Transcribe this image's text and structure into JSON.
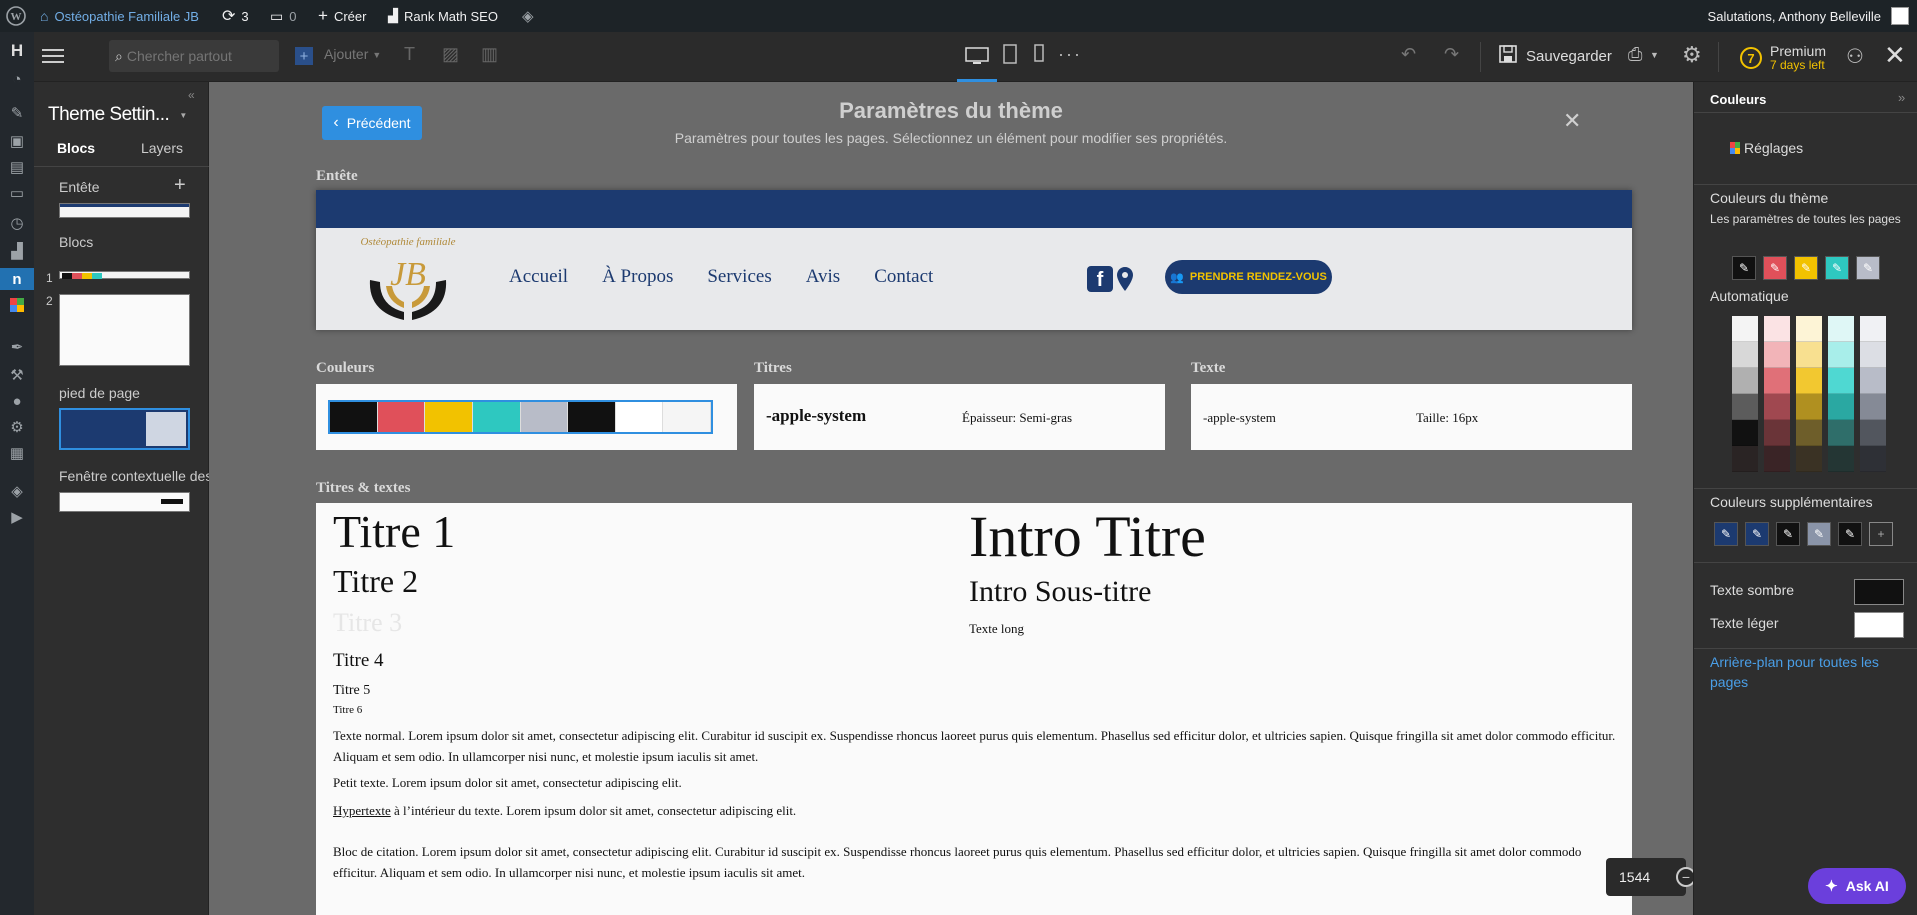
{
  "adminbar": {
    "site_name": "Ostéopathie Familiale JB",
    "updates": "3",
    "comments": "0",
    "create": "Créer",
    "rankmath": "Rank Math SEO",
    "greeting": "Salutations, Anthony Belleville"
  },
  "toolbar": {
    "search_placeholder": "Chercher partout",
    "add_label": "Ajouter",
    "save_label": "Sauvegarder",
    "premium_label": "Premium",
    "premium_days": "7 days left",
    "premium_count": "7"
  },
  "leftpanel": {
    "title": "Theme Settin...",
    "tabs": [
      "Blocs",
      "Layers"
    ],
    "sections": {
      "header": "Entête",
      "blocks": "Blocs",
      "footer": "pied de page",
      "popup": "Fenêtre contextuelle des"
    },
    "block_numbers": [
      "1",
      "2"
    ]
  },
  "canvas": {
    "back_button": "Précédent",
    "title": "Paramètres du thème",
    "subtitle": "Paramètres pour toutes les pages. Sélectionnez un élément pour modifier ses propriétés.",
    "header_label": "Entête",
    "nav": [
      "Accueil",
      "À Propos",
      "Services",
      "Avis",
      "Contact"
    ],
    "logo_script": "Ostéopathie familiale",
    "logo_initials": "JB",
    "cta": "PRENDRE RENDEZ-VOUS",
    "colors_label": "Couleurs",
    "titles_label": "Titres",
    "text_label": "Texte",
    "palette": [
      "#111111",
      "#e0505a",
      "#f2c200",
      "#2ec8c0",
      "#b8bcc8",
      "#111111",
      "#ffffff",
      "#f5f5f5"
    ],
    "titles_font": "-apple-system",
    "titles_weight": "Épaisseur: Semi-gras",
    "text_font": "-apple-system",
    "text_size": "Taille: 16px",
    "titles_texts_label": "Titres & textes",
    "h1": "Titre 1",
    "h2": "Titre 2",
    "h3": "Titre 3",
    "h4": "Titre 4",
    "h5": "Titre 5",
    "h6": "Titre 6",
    "intro_title": "Intro Titre",
    "intro_subtitle": "Intro Sous-titre",
    "long_text": "Texte long",
    "normal_text": "Texte normal. Lorem ipsum dolor sit amet, consectetur adipiscing elit. Curabitur id suscipit ex. Suspendisse rhoncus laoreet purus quis elementum. Phasellus sed efficitur dolor, et ultricies sapien. Quisque fringilla sit amet dolor commodo efficitur. Aliquam et sem odio. In ullamcorper nisi nunc, et molestie ipsum iaculis sit amet.",
    "small_text": "Petit texte. Lorem ipsum dolor sit amet, consectetur adipiscing elit.",
    "link_word": "Hypertexte",
    "link_rest": " à l’intérieur du texte. Lorem ipsum dolor sit amet, consectetur adipiscing elit.",
    "quote_text": "Bloc de citation. Lorem ipsum dolor sit amet, consectetur adipiscing elit. Curabitur id suscipit ex. Suspendisse rhoncus laoreet purus quis elementum. Phasellus sed efficitur dolor, et ultricies sapien. Quisque fringilla sit amet dolor commodo efficitur. Aliquam et sem odio. In ullamcorper nisi nunc, et molestie ipsum iaculis sit amet.",
    "width_value": "1544"
  },
  "rightpanel": {
    "title": "Couleurs",
    "reglages": "Réglages",
    "theme_colors": "Couleurs du thème",
    "theme_colors_desc": "Les paramètres de toutes les pages",
    "theme_swatches": [
      "#111111",
      "#e0505a",
      "#f2c200",
      "#2ec8c0",
      "#b8bcc8"
    ],
    "auto_label": "Automatique",
    "auto_columns": [
      [
        "#f4f4f4",
        "#d8d8d8",
        "#b0b0b0",
        "#5c5c5c",
        "#111111",
        "#2a2424"
      ],
      [
        "#fbe3e4",
        "#f2b4b8",
        "#e07078",
        "#a04850",
        "#6a3438",
        "#3a2426"
      ],
      [
        "#fdf4d6",
        "#f8e090",
        "#f2c830",
        "#b09020",
        "#6e5e2a",
        "#3a3224"
      ],
      [
        "#dff7f6",
        "#a8eeea",
        "#4fd8d2",
        "#2aa8a2",
        "#2f6e6a",
        "#243634"
      ],
      [
        "#f0f1f4",
        "#dcdee4",
        "#b8bcc8",
        "#858a96",
        "#52565e",
        "#2e3036"
      ]
    ],
    "extra_colors": "Couleurs supplémentaires",
    "extra_swatches": [
      "#1c3a70",
      "#1c3a70",
      "#111111",
      "#8a94a8",
      "#111111"
    ],
    "dark_text": "Texte sombre",
    "light_text": "Texte léger",
    "dark_text_color": "#111111",
    "light_text_color": "#ffffff",
    "bg_link": "Arrière-plan pour toutes les pages"
  },
  "ask_ai": "Ask AI"
}
